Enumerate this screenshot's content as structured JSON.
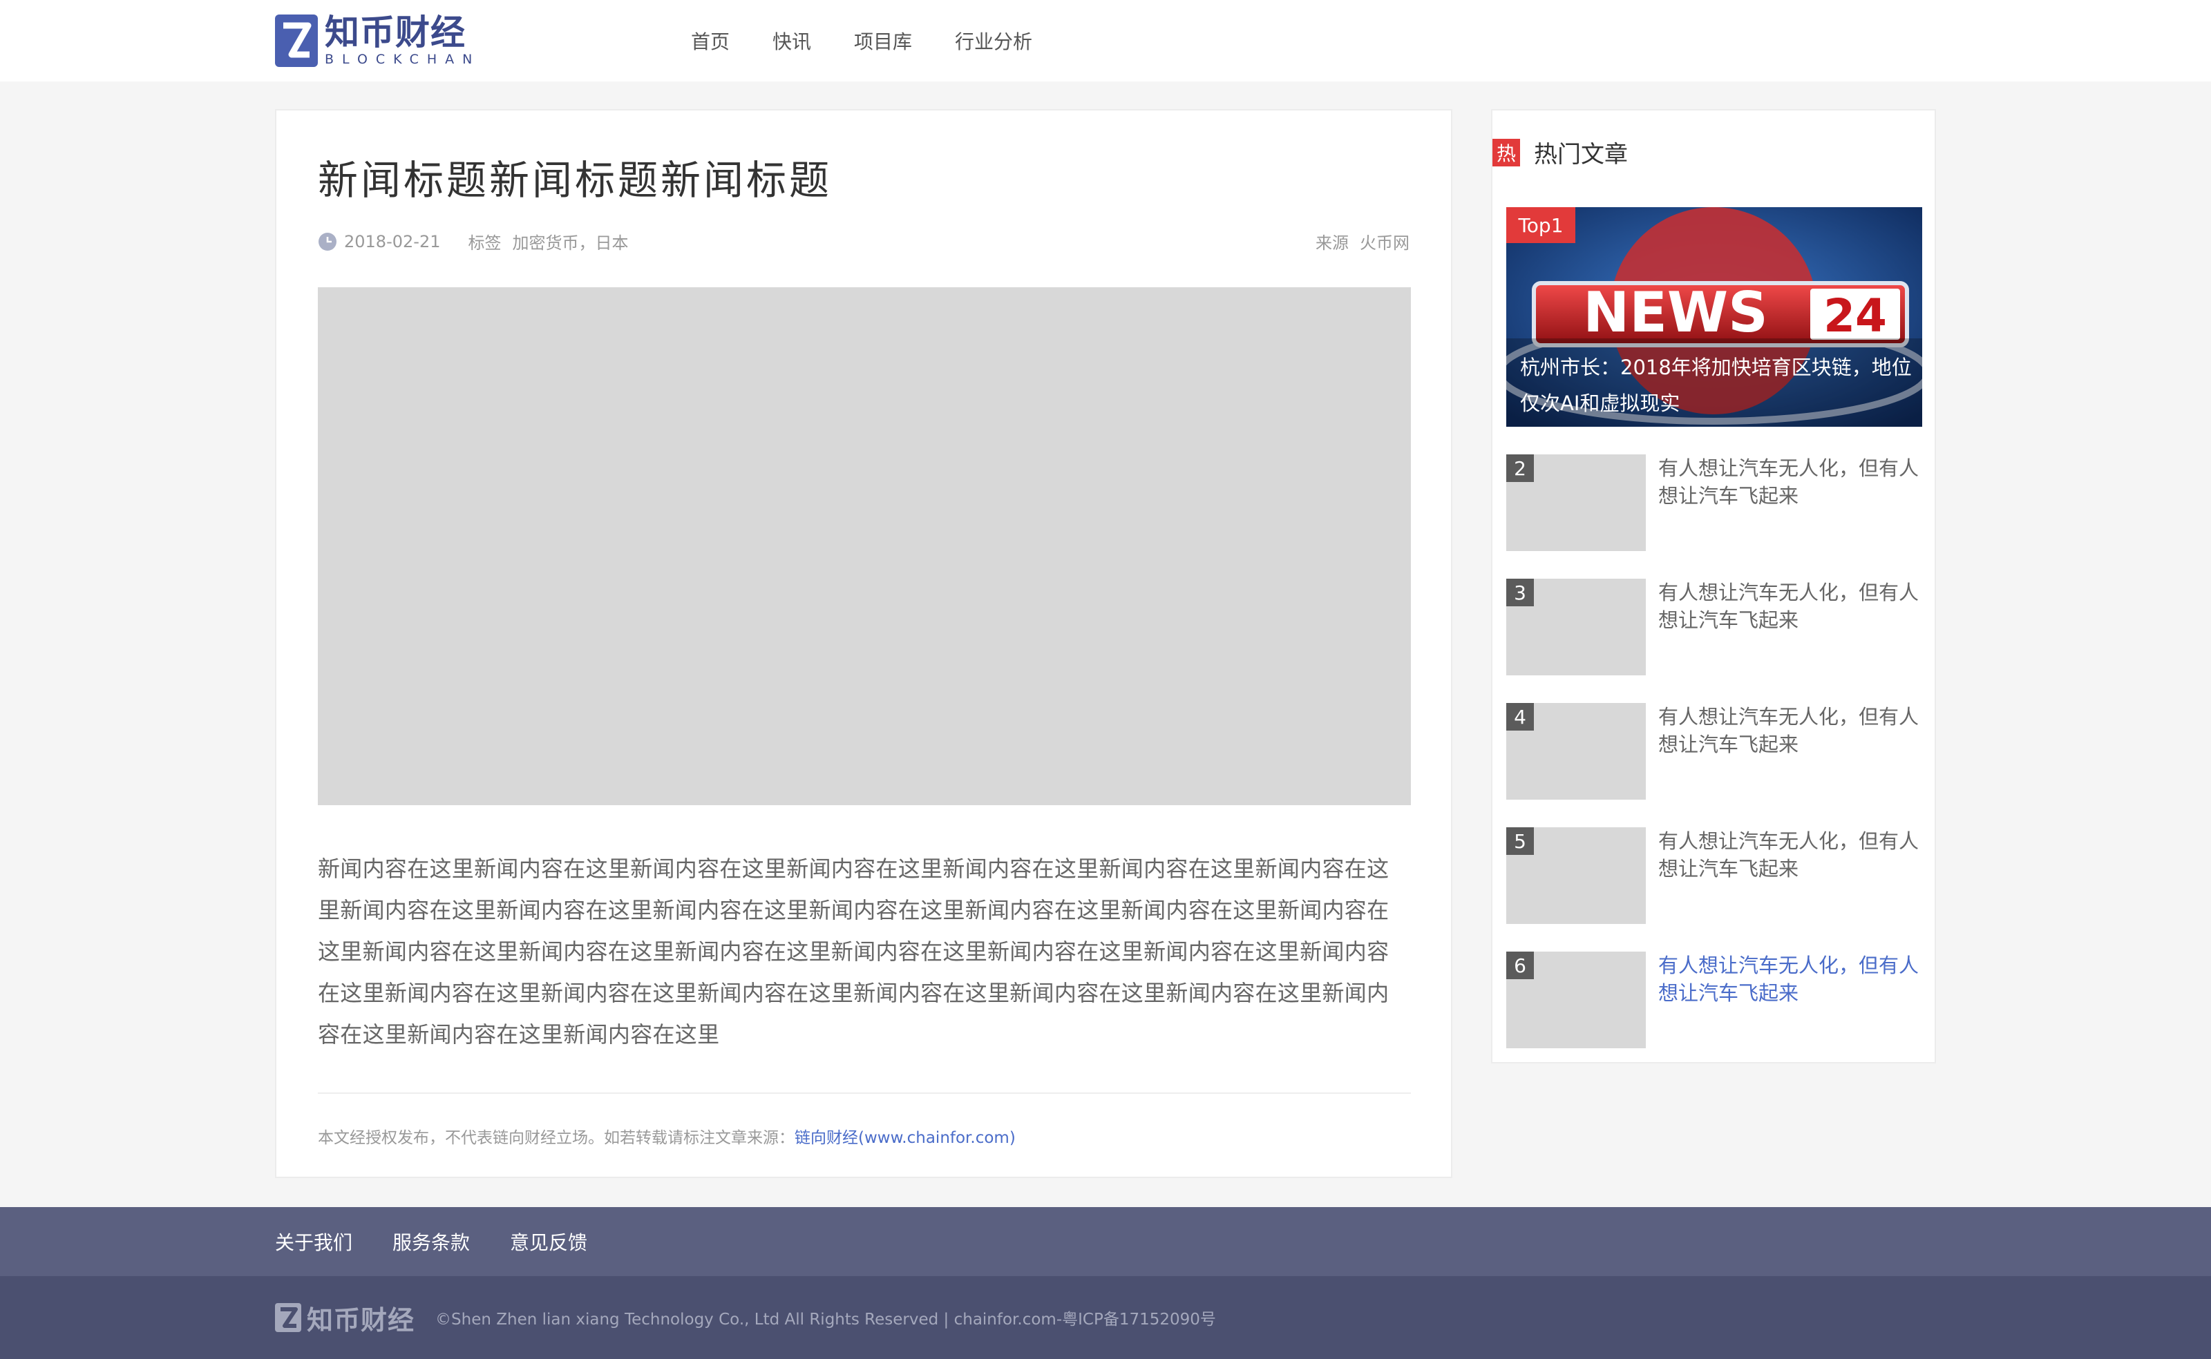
{
  "header": {
    "logo_cn": "知币财经",
    "logo_en": "BLOCKCHAN",
    "nav": [
      "首页",
      "快讯",
      "项目库",
      "行业分析"
    ]
  },
  "article": {
    "title": "新闻标题新闻标题新闻标题",
    "date": "2018-02-21",
    "tag_label": "标签",
    "tags": "加密货币，日本",
    "source_label": "来源",
    "source": "火币网",
    "body": "新闻内容在这里新闻内容在这里新闻内容在这里新闻内容在这里新闻内容在这里新闻内容在这里新闻内容在这里新闻内容在这里新闻内容在这里新闻内容在这里新闻内容在这里新闻内容在这里新闻内容在这里新闻内容在这里新闻内容在这里新闻内容在这里新闻内容在这里新闻内容在这里新闻内容在这里新闻内容在这里新闻内容在这里新闻内容在这里新闻内容在这里新闻内容在这里新闻内容在这里新闻内容在这里新闻内容在这里新闻内容在这里新闻内容在这里新闻内容在这里",
    "note_prefix": "本文经授权发布，不代表链向财经立场。如若转载请标注文章来源：",
    "note_link": "链向财经(www.chainfor.com)"
  },
  "sidebar": {
    "badge": "热",
    "title": "热门文章",
    "top1": {
      "badge": "Top1",
      "caption": "杭州市长：2018年将加快培育区块链，地位仅次AI和虚拟现实",
      "image_text": "NEWS",
      "image_num": "24"
    },
    "items": [
      {
        "rank": "2",
        "text": "有人想让汽车无人化，但有人想让汽车飞起来"
      },
      {
        "rank": "3",
        "text": "有人想让汽车无人化，但有人想让汽车飞起来"
      },
      {
        "rank": "4",
        "text": "有人想让汽车无人化，但有人想让汽车飞起来"
      },
      {
        "rank": "5",
        "text": "有人想让汽车无人化，但有人想让汽车飞起来"
      },
      {
        "rank": "6",
        "text": "有人想让汽车无人化，但有人想让汽车飞起来"
      }
    ]
  },
  "footer": {
    "links": [
      "关于我们",
      "服务条款",
      "意见反馈"
    ],
    "logo_text": "知币财经",
    "copyright": "©Shen Zhen lian xiang Technology Co., Ltd All Rights Reserved | chainfor.com-粤ICP备17152090号"
  },
  "colors": {
    "accent_red": "#e23a3a",
    "link_blue": "#4a6cc9",
    "footer_top": "#5b6080",
    "footer_bottom": "#4b5070",
    "logo": "#3c4a8c"
  }
}
